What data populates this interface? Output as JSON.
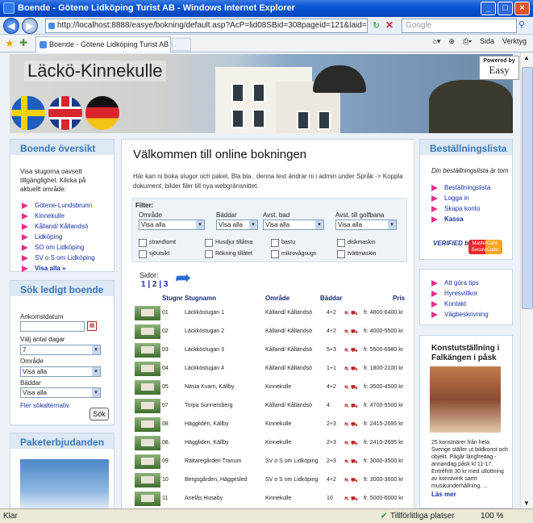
{
  "browser": {
    "title": "Boende - Götene Lidköping Turist AB - Windows Internet Explorer",
    "url": "http://localhost:8888/easye/bokning/default.asp?AcP=lid08SBid=308pageid=121&laid=1&HttpSite=0",
    "search_placeholder": "Google",
    "tab_title": "Boende - Götene Lidköping Turist AB",
    "tools": [
      "Sida",
      "Verktyg"
    ],
    "status_left": "Klar",
    "status_zone": "Tillförlitliga platser",
    "zoom": "100 %"
  },
  "header": {
    "site_title": "Läckö-Kinnekulle",
    "powered_by": "Powered by",
    "powered_brand": "Easy"
  },
  "left": {
    "overview_title": "Boende översikt",
    "overview_intro": "Visa stugorna oavsett tillgänglighet. Klicka på aktuellt område:",
    "areas": [
      "Götene-Lundsbrunn",
      "Kinnekulle",
      "Kålland/ Kållandsö",
      "Lidköping",
      "SO om Lidköping",
      "SV o S om Lidköping",
      "Visa alla »"
    ],
    "search_title": "Sök ledigt boende",
    "arrival_label": "Ankomstdatum",
    "days_label": "Välj antal dagar",
    "days_value": "7",
    "area_label": "Område",
    "area_value": "Visa alla",
    "beds_label": "Bäddar",
    "beds_value": "Visa alla",
    "more_options": "Fler sökalternativ",
    "search_button": "Sök",
    "packages_title": "Paketerbjudanden"
  },
  "main": {
    "title": "Välkommen till online bokningen",
    "intro": "Här kan ni boka stugor och paket. Bla bla.. denna text ändrar ni i admin under Språk -> Koppla dokument, bilder filer till nya webgränsnittet.",
    "filter_label": "Filter:",
    "filters": [
      {
        "label": "Område",
        "value": "Visa alla"
      },
      {
        "label": "Bäddar",
        "value": "Visa alla"
      },
      {
        "label": "Avst. bad",
        "value": "Visa alla"
      },
      {
        "label": "Avst. till golfbana",
        "value": "Visa alla"
      }
    ],
    "checkboxes": [
      "strandtomt",
      "Husdjur tillåtna",
      "bastu",
      "diskmaskin",
      "sjöutsikt",
      "Rökning tillåtet",
      "mikrovågsugn",
      "tvättmaskin"
    ],
    "pages_label": "Sidor:",
    "pages": "1 | 2 | 3",
    "columns": [
      "Stugnr",
      "Stugnamn",
      "Område",
      "Bäddar",
      "Pris"
    ],
    "rows": [
      {
        "nr": "01",
        "name": "Läckköstugan 1",
        "area": "Kålland/ Kållandsö",
        "beds": "4+2",
        "price": "fr. 4800-6400 kr"
      },
      {
        "nr": "02",
        "name": "Läckköstugan 2",
        "area": "Kålland/ Kållandsö",
        "beds": "4+2",
        "price": "fr. 4000-5500 kr"
      },
      {
        "nr": "03",
        "name": "Läckköstugan 3",
        "area": "Kålland/ Kållandsö",
        "beds": "5+3",
        "price": "fr. 5500-6980 kr"
      },
      {
        "nr": "04",
        "name": "Läckköstugan 4",
        "area": "Kålland/ Kållandsö",
        "beds": "1+1",
        "price": "fr. 1800-2100 kr"
      },
      {
        "nr": "05",
        "name": "Nästa Kvarn, Källby",
        "area": "Kinnekulle",
        "beds": "4+2",
        "price": "fr. 3500-4500 kr"
      },
      {
        "nr": "07",
        "name": "Torpa Sunnersberg",
        "area": "Kålland/ Kållandsö",
        "beds": "4",
        "price": "fr. 4700-5500 kr"
      },
      {
        "nr": "08",
        "name": "Häggliden, Källby",
        "area": "Kinnekulle",
        "beds": "2+3",
        "price": "fr. 2415-2695 kr"
      },
      {
        "nr": "08.",
        "name": "Häggliden, Källby",
        "area": "Kinnekulle",
        "beds": "2+3",
        "price": "fr. 2415-2695 kr"
      },
      {
        "nr": "09",
        "name": "Rättaregården Tranum",
        "area": "SV o S om Lidköping",
        "beds": "2+3",
        "price": "fr. 3000-3500 kr"
      },
      {
        "nr": "10",
        "name": "Bergsgården, Häggesled",
        "area": "SV o S om Lidköping",
        "beds": "4+2",
        "price": "fr. 3000-3600 kr"
      },
      {
        "nr": "11",
        "name": "Anelås Husaby",
        "area": "Kinnekulle",
        "beds": "10",
        "price": "fr. 5000-6000 kr"
      }
    ]
  },
  "right": {
    "order_title": "Beställningslista",
    "order_empty": "Din beställningslista är tom",
    "order_links": [
      "Beställningslista",
      "Logga in",
      "Skapa konto",
      "Kassa"
    ],
    "visa": "VERIFIED by VISA",
    "mastercard": "MasterCard. SecureCode.",
    "info_links": [
      "Att göra tips",
      "Hyresvillkor",
      "Kontakt",
      "Vägbeskrivning"
    ],
    "news_title": "Konstutställning i Falkängen i påsk",
    "news_text": "25 konstnärer från hela Sverige ställer ut bildkonst och objekt. Pågår långfredag - annandag påsk kl 11-17. Entréfritt 30 kr med utlottning av konstverk samt musikunderhållning. ...",
    "news_more": "Läs mer"
  }
}
